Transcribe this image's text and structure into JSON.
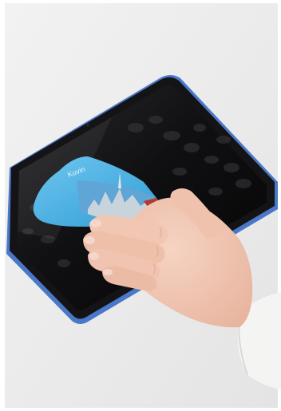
{
  "scene": {
    "background_color": "#eaeaea",
    "border_color": "#ffffff",
    "tablet": {
      "frame_color": "#4a78c8",
      "bezel_color": "#141416",
      "screen_color": "#0b0b0d",
      "icon": "tablet-icon"
    },
    "cloth": {
      "color": "#49b3e8",
      "print_sky_color": "#5fa6d6",
      "print_city_color": "#c9d3dc",
      "print_accent_color": "#b23a2a",
      "printed_text": "Kuvin",
      "icon": "cleaning-cloth-icon"
    },
    "hand": {
      "skin_color": "#f1c7b3",
      "nail_color": "#f5d6cb",
      "sleeve_color": "#f4f4f2",
      "icon": "hand-icon"
    }
  }
}
